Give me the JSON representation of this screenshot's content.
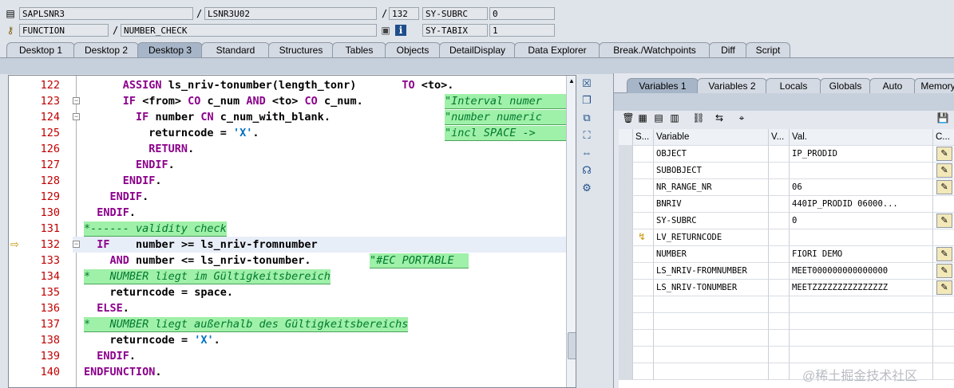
{
  "header": {
    "row1": {
      "program": "SAPLSNR3",
      "include": "LSNR3U02",
      "line": "132",
      "sys_label": "SY-SUBRC",
      "sys_value": "0"
    },
    "row2": {
      "type": "FUNCTION",
      "name": "NUMBER_CHECK",
      "sys_label": "SY-TABIX",
      "sys_value": "1"
    },
    "separator": "/"
  },
  "desktop_tabs": [
    "Desktop 1",
    "Desktop 2",
    "Desktop 3",
    "Standard",
    "Structures",
    "Tables",
    "Objects",
    "DetailDisplay",
    "Data Explorer",
    "Break./Watchpoints",
    "Diff",
    "Script"
  ],
  "active_desktop_tab": "Desktop 3",
  "code_lines": [
    {
      "n": "122",
      "text": "      ASSIGN ls_nriv-tonumber(length_tonr)       TO <to>."
    },
    {
      "n": "123",
      "text": "      IF <from> CO c_num AND <to> CO c_num.",
      "comment": "\"Interval numer"
    },
    {
      "n": "124",
      "text": "        IF number CN c_num_with_blank.",
      "comment": "\"number numeric"
    },
    {
      "n": "125",
      "text": "          returncode = 'X'.",
      "comment": "\"incl SPACE ->"
    },
    {
      "n": "126",
      "text": "          RETURN."
    },
    {
      "n": "127",
      "text": "        ENDIF."
    },
    {
      "n": "128",
      "text": "      ENDIF."
    },
    {
      "n": "129",
      "text": "    ENDIF."
    },
    {
      "n": "130",
      "text": "  ENDIF."
    },
    {
      "n": "131",
      "text": "*------ validity check"
    },
    {
      "n": "132",
      "text": "  IF    number >= ls_nriv-fromnumber"
    },
    {
      "n": "133",
      "text": "    AND number <= ls_nriv-tonumber.",
      "comment": "\"#EC PORTABLE"
    },
    {
      "n": "134",
      "text": "*   NUMBER liegt im Gültigkeitsbereich"
    },
    {
      "n": "135",
      "text": "    returncode = space."
    },
    {
      "n": "136",
      "text": "  ELSE."
    },
    {
      "n": "137",
      "text": "*   NUMBER liegt außerhalb des Gültigkeitsbereichs"
    },
    {
      "n": "138",
      "text": "    returncode = 'X'."
    },
    {
      "n": "139",
      "text": "  ENDIF."
    },
    {
      "n": "140",
      "text": "ENDFUNCTION."
    }
  ],
  "variable_tabs": [
    "Variables 1",
    "Variables 2",
    "Locals",
    "Globals",
    "Auto",
    "Memory"
  ],
  "active_variable_tab": "Variables 1",
  "variables_header": {
    "s": "S...",
    "variable": "Variable",
    "v": "V...",
    "val": "Val.",
    "c": "C..."
  },
  "variables": [
    {
      "name": "OBJECT",
      "value": "IP_PRODID",
      "edit": true
    },
    {
      "name": "SUBOBJECT",
      "value": "",
      "edit": true
    },
    {
      "name": "NR_RANGE_NR",
      "value": "06",
      "edit": true
    },
    {
      "name": "BNRIV",
      "value": "440IP_PRODID         06000...",
      "edit": false
    },
    {
      "name": "SY-SUBRC",
      "value": "0",
      "edit": true
    },
    {
      "name": "LV_RETURNCODE",
      "value": "",
      "edit": false
    },
    {
      "name": "NUMBER",
      "value": "FIORI DEMO",
      "edit": true
    },
    {
      "name": "LS_NRIV-FROMNUMBER",
      "value": "MEET000000000000000",
      "edit": true
    },
    {
      "name": "LS_NRIV-TONUMBER",
      "value": "MEETZZZZZZZZZZZZZZZ",
      "edit": true
    }
  ],
  "watermark": "@稀土掘金技术社区",
  "icons": {
    "doc": "document-icon",
    "key": "key-icon",
    "pin": "pin-icon",
    "info": "info-icon",
    "arrow": "current-line-arrow-icon",
    "close": "close-icon",
    "edit": "pencil-icon",
    "save": "save-icon"
  }
}
